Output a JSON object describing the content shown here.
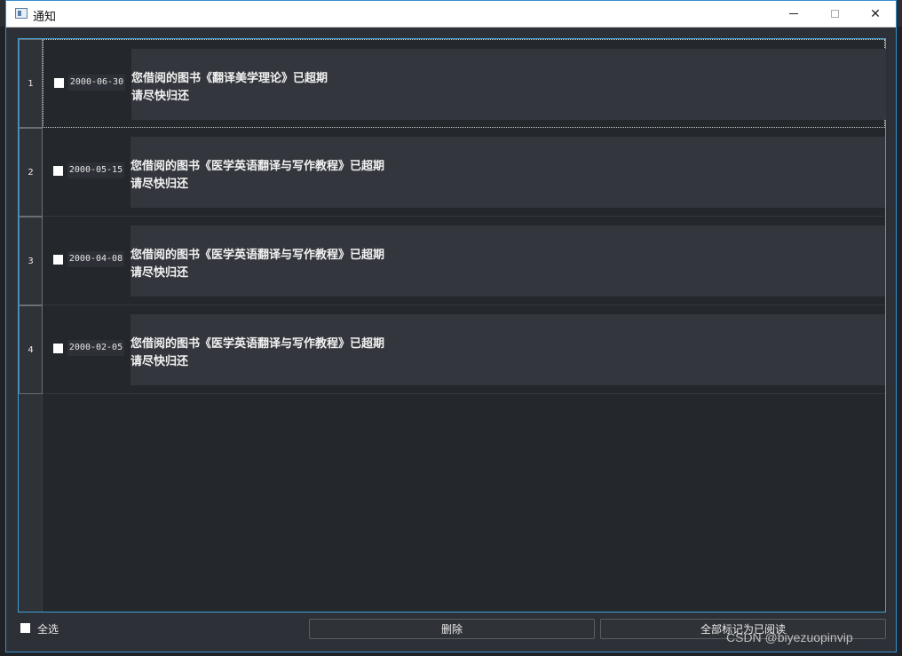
{
  "window": {
    "title": "通知"
  },
  "notifications": [
    {
      "index": "1",
      "date": "2000-06-30",
      "line1": "您借阅的图书《翻译美学理论》已超期",
      "line2": "请尽快归还"
    },
    {
      "index": "2",
      "date": "2000-05-15",
      "line1": "您借阅的图书《医学英语翻译与写作教程》已超期",
      "line2": "请尽快归还"
    },
    {
      "index": "3",
      "date": "2000-04-08",
      "line1": "您借阅的图书《医学英语翻译与写作教程》已超期",
      "line2": "请尽快归还"
    },
    {
      "index": "4",
      "date": "2000-02-05",
      "line1": "您借阅的图书《医学英语翻译与写作教程》已超期",
      "line2": "请尽快归还"
    }
  ],
  "footer": {
    "select_all_label": "全选",
    "delete_label": "删除",
    "mark_all_read_label": "全部标记为已阅读"
  },
  "watermark": "CSDN @biyezuopinvip"
}
